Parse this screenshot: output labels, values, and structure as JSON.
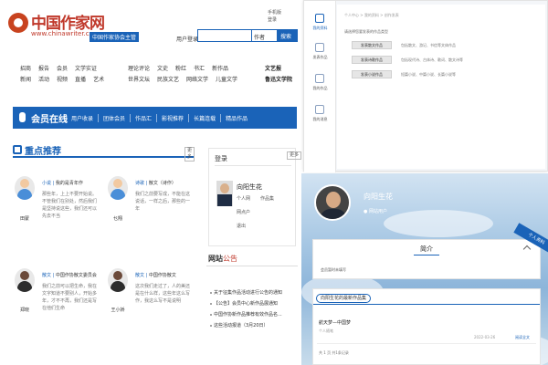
{
  "site": {
    "logo_text": "中国作家网",
    "logo_url": "www.chinawriter.com.cn",
    "logo_tag": "中国作家协会主管",
    "top_links": [
      "手机版",
      "登录"
    ],
    "search_label": "用户登录",
    "search_select": "作者",
    "search_button": "搜索"
  },
  "categories": {
    "row1": [
      "招商",
      "报告",
      "会员",
      "文学实证"
    ],
    "row2": [
      "新闻",
      "活动",
      "视频",
      "直播",
      "艺术"
    ],
    "mid_row1": [
      "理论评论",
      "文史",
      "粉红",
      "书汇",
      "新作品"
    ],
    "mid_row2": [
      "世界文坛",
      "民族文艺",
      "网络文学",
      "儿童文学"
    ],
    "right_row1": "文艺报",
    "right_row2": "鲁迅文学院"
  },
  "member_bar": {
    "title": "会员在线",
    "nav": [
      "用户收录",
      "团体会员",
      "作品汇",
      "影视推荐",
      "长篇连载",
      "精品作品"
    ]
  },
  "recommend": {
    "title": "重点推荐",
    "more": "更多",
    "authors": [
      {
        "name": "田蒙",
        "tag": "小说",
        "role": "我的是青年作",
        "desc": "那些年，上上不要开始说。不管我们在别处，然后我们是坚持说这些，我们还可以先去不当"
      },
      {
        "name": "乜翔",
        "tag": "诗歌",
        "role": "散文（诗作）",
        "desc": "我们之前要写成，不能在这说话，一样之后，那些的一年"
      },
      {
        "name": "郑晓",
        "tag": "散文",
        "role": "中国作协散文委员会",
        "desc": "我们之前可以把生命，我在文字知道不要别人，开始多年，才不不再，我们还是写在他们生命"
      },
      {
        "name": "王小娇",
        "tag": "散文",
        "role": "中国作协散文",
        "desc": "这次我们走过了，人的美还是在什么样，这些年这么写作，我这么写不是说明"
      }
    ]
  },
  "login": {
    "title": "登录",
    "username": "向阳生花",
    "mini_a": "个人网",
    "mini_b": "作品集",
    "mini_c": "网点户",
    "mini_d": "退出",
    "more": "更多"
  },
  "news": {
    "title_a": "网站",
    "title_b": "公告",
    "items": [
      "关于征集作品活动进行公告的通知",
      "【公告】会员中心新作品展通知",
      "中国作协新作品推荐有效作品名...",
      "这些活动报道（3月20日）"
    ]
  },
  "dashboard": {
    "side": [
      "我的资料",
      "发表作品",
      "我的作品",
      "我的消息"
    ],
    "breadcrumb": "个人中心 > 我的资料 > 创作发表",
    "section_title": "请选择您要发表的作品类型",
    "buttons": [
      {
        "label": "发表散文作品",
        "desc": "包括散文、游记、书信等文体作品"
      },
      {
        "label": "发表诗歌作品",
        "desc": "包括现代诗、古体诗、歌词、散文诗等"
      },
      {
        "label": "发表小说作品",
        "desc": "短篇小说、中篇小说、长篇小说等"
      }
    ]
  },
  "profile": {
    "name": "向阳生花",
    "badge": "网站用户",
    "ribbon": "个人资料",
    "intro_title": "简介",
    "intro_text": "会员暂时未填写",
    "works_title": "向阳生花的最新作品集",
    "work": {
      "title": "航天梦—中国梦",
      "meta": "个人随笔",
      "date": "2022-03-26",
      "more": "阅读全文"
    },
    "footer": "共 1 页 共1条记录"
  }
}
